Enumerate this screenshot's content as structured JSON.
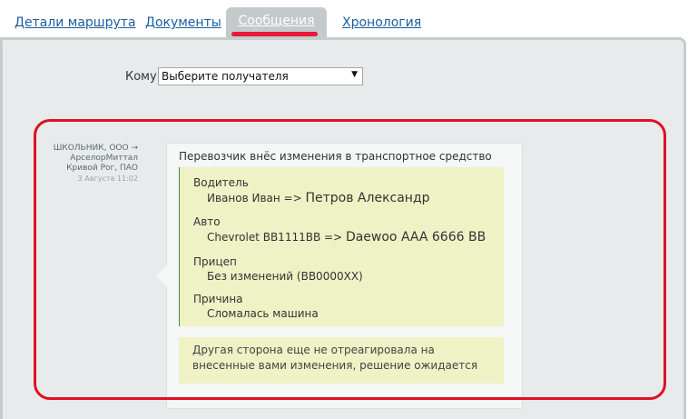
{
  "tabs": {
    "route_details": "Детали маршрута",
    "documents": "Документы",
    "messages": "Сообщения",
    "history": "Хронология"
  },
  "recipient": {
    "label": "Кому",
    "selected": "Выберите получателя"
  },
  "message": {
    "sender": "ШКОЛЬНИК, ООО → АрселорМиттал Кривой Рог, ПАО",
    "date": "3 Августа 11:02",
    "title": "Перевозчик внёс изменения в транспортное средство",
    "driver": {
      "label": "Водитель",
      "old": "Иванов Иван =>",
      "new": "Петров Александр"
    },
    "vehicle": {
      "label": "Авто",
      "old": "Chevrolet BB1111BB =>",
      "new": "Daewoo AAA 6666 BB"
    },
    "trailer": {
      "label": "Прицеп",
      "value": "Без изменений (BB0000XX)"
    },
    "reason": {
      "label": "Причина",
      "value": "Сломалась машина"
    },
    "notice": "Другая сторона еще не отреагировала на внесенные вами изменения, решение ожидается"
  },
  "colors": {
    "link": "#1a5e9e",
    "active_tab_bg": "#c4c9cc",
    "active_tab_underline": "#e8193a",
    "highlight": "#e0101f",
    "changes_bg": "#eef2c5"
  }
}
